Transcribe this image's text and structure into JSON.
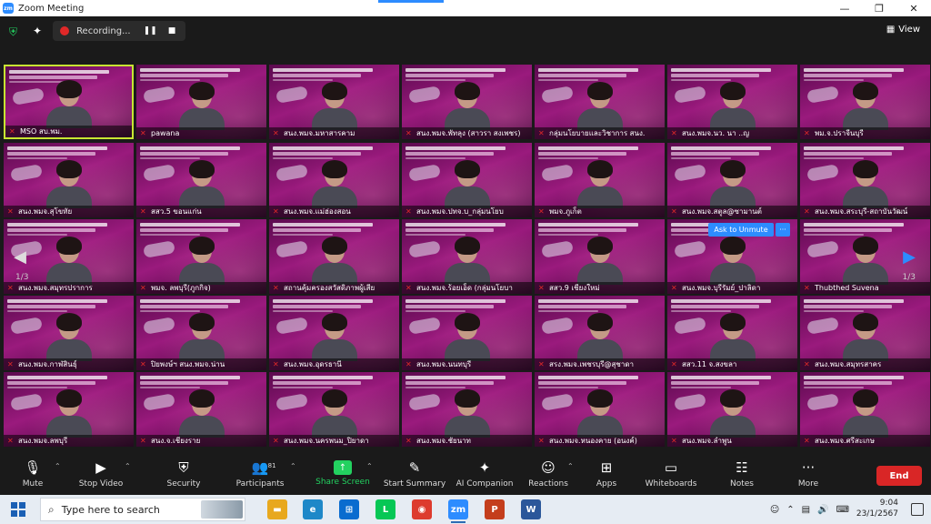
{
  "window": {
    "title": "Zoom Meeting",
    "minimize": "—",
    "restore": "❐",
    "close": "✕"
  },
  "topbar": {
    "recording_label": "Recording...",
    "view_label": "View"
  },
  "pager": {
    "left": "1/3",
    "right": "1/3"
  },
  "unmute": {
    "label": "Ask to Unmute",
    "more": "···"
  },
  "tiles": [
    [
      "MSO สบ.พม.",
      "pawana",
      "สนง.พมจ.มหาสารคาม",
      "สนง.พมจ.พัทลุง (สาวรา สงเพชร)",
      "กลุ่มนโยบายและวิชาการ สนง.",
      "สนง.พมจ.นว. นา ..ญ",
      "พม.จ.ปราจีนบุรี"
    ],
    [
      "สนง.พมจ.สุโขทัย",
      "สสว.5 ขอนแก่น",
      "สนง.พมจ.แม่ฮ่องสอน",
      "สนง.พมจ.ปทจ.บ_กลุ่มนโยบ",
      "พมจ.ภูเก็ต",
      "สนง.พมจ.สตูล@ซามานต์",
      "สนง.พมจ.สระบุรี-สถาบันวัฒน์"
    ],
    [
      "สนง.พมจ.สมุทรปราการ",
      "พมจ. ลพบุรี(ภูกกิจ)",
      "สถานคุ้มครองสวัสดิภาพผู้เสีย",
      "สนง.พมจ.ร้อยเอ็ด (กลุ่มนโยบา",
      "สสว.9 เชียงใหม่",
      "สนง.พมจ.บุรีรัมย์_ปาลิดา",
      "Thubthed Suvena"
    ],
    [
      "สนง.พมจ.กาฬสินธุ์",
      "ปิยพงษ์ฯ สนง.พมจ.น่าน",
      "สนง.พมจ.อุดรธานี",
      "สนง.พมจ.นนทบุรี",
      "สรง.พมจ.เพชรบุรี@สุชาดา",
      "สสว.11 จ.สงขลา",
      "สนง.พมจ.สมุทรสาคร"
    ],
    [
      "สนง.พมจ.ลพบุรี",
      "สนง.จ.เชียงราย",
      "สนง.พมจ.นครพนม_ปิยาดา",
      "สนง.พมจ.ชัยนาท",
      "สนง.พมจ.หนองคาย (อนงค์)",
      "สนง.พมจ.ลำพูน",
      "สนง.พมจ.ศรีสะเกษ"
    ]
  ],
  "toolbar": {
    "mute": "Mute",
    "stop_video": "Stop Video",
    "security": "Security",
    "participants": "Participants",
    "participants_count": "81",
    "share_screen": "Share Screen",
    "start_summary": "Start Summary",
    "ai_companion": "AI Companion",
    "reactions": "Reactions",
    "apps": "Apps",
    "whiteboards": "Whiteboards",
    "notes": "Notes",
    "more": "More",
    "end": "End"
  },
  "taskbar": {
    "search_placeholder": "Type here to search",
    "time": "9:04",
    "date": "23/1/2567"
  },
  "colors": {
    "accent": "#2d8cff",
    "end": "#d92626",
    "share": "#23d160",
    "active_border": "#c8e632"
  }
}
